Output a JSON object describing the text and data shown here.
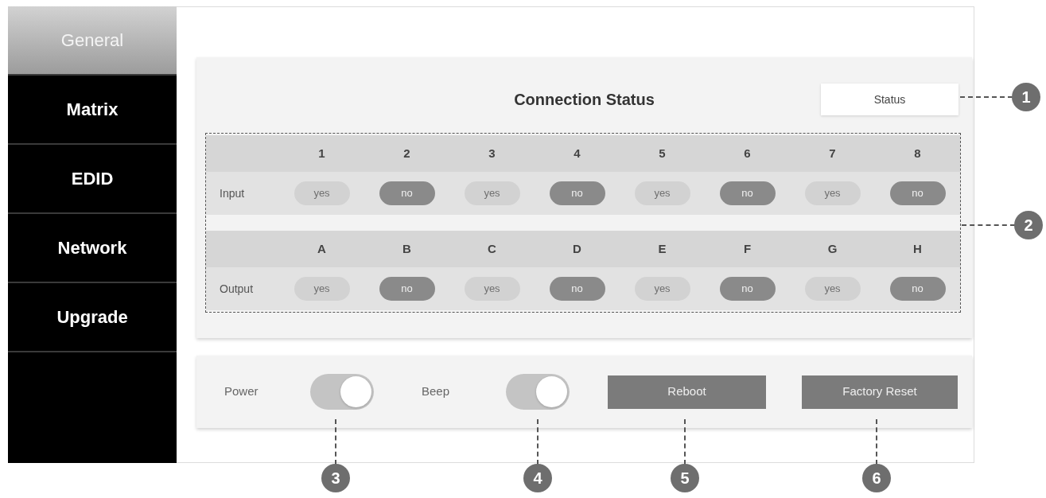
{
  "sidebar": {
    "items": [
      {
        "label": "General",
        "selected": true
      },
      {
        "label": "Matrix",
        "selected": false
      },
      {
        "label": "EDID",
        "selected": false
      },
      {
        "label": "Network",
        "selected": false
      },
      {
        "label": "Upgrade",
        "selected": false
      }
    ]
  },
  "connection_status": {
    "title": "Connection Status",
    "status_button": "Status",
    "groups": [
      {
        "label": "Input",
        "ports": [
          {
            "header": "1",
            "value": "yes",
            "connected": true
          },
          {
            "header": "2",
            "value": "no",
            "connected": false
          },
          {
            "header": "3",
            "value": "yes",
            "connected": true
          },
          {
            "header": "4",
            "value": "no",
            "connected": false
          },
          {
            "header": "5",
            "value": "yes",
            "connected": true
          },
          {
            "header": "6",
            "value": "no",
            "connected": false
          },
          {
            "header": "7",
            "value": "yes",
            "connected": true
          },
          {
            "header": "8",
            "value": "no",
            "connected": false
          }
        ]
      },
      {
        "label": "Output",
        "ports": [
          {
            "header": "A",
            "value": "yes",
            "connected": true
          },
          {
            "header": "B",
            "value": "no",
            "connected": false
          },
          {
            "header": "C",
            "value": "yes",
            "connected": true
          },
          {
            "header": "D",
            "value": "no",
            "connected": false
          },
          {
            "header": "E",
            "value": "yes",
            "connected": true
          },
          {
            "header": "F",
            "value": "no",
            "connected": false
          },
          {
            "header": "G",
            "value": "yes",
            "connected": true
          },
          {
            "header": "H",
            "value": "no",
            "connected": false
          }
        ]
      }
    ]
  },
  "controls": {
    "toggles": [
      {
        "label": "Power",
        "on": true
      },
      {
        "label": "Beep",
        "on": true
      }
    ],
    "buttons": [
      "Reboot",
      "Factory Reset"
    ]
  },
  "callouts": [
    "1",
    "2",
    "3",
    "4",
    "5",
    "6"
  ]
}
